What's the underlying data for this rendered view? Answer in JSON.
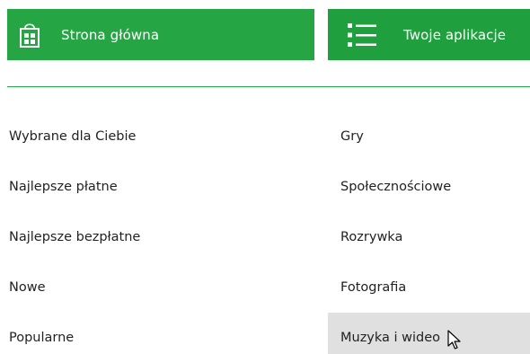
{
  "header": {
    "home_tile": {
      "label": "Strona główna",
      "icon": "store-bag-icon",
      "color": "#26a544"
    },
    "apps_tile": {
      "label": "Twoje aplikacje",
      "icon": "list-icon",
      "color": "#1f9f3d"
    }
  },
  "separator_color": "#2aa64a",
  "menu": {
    "left": [
      {
        "label": "Wybrane dla Ciebie"
      },
      {
        "label": "Najlepsze płatne"
      },
      {
        "label": "Najlepsze bezpłatne"
      },
      {
        "label": "Nowe"
      },
      {
        "label": "Popularne"
      }
    ],
    "right": [
      {
        "label": "Gry"
      },
      {
        "label": "Społecznościowe"
      },
      {
        "label": "Rozrywka"
      },
      {
        "label": "Fotografia"
      },
      {
        "label": "Muzyka i wideo",
        "hovered": true
      }
    ]
  },
  "hover_color": "#e0e0e0",
  "cursor": {
    "icon": "mouse-pointer-icon"
  }
}
